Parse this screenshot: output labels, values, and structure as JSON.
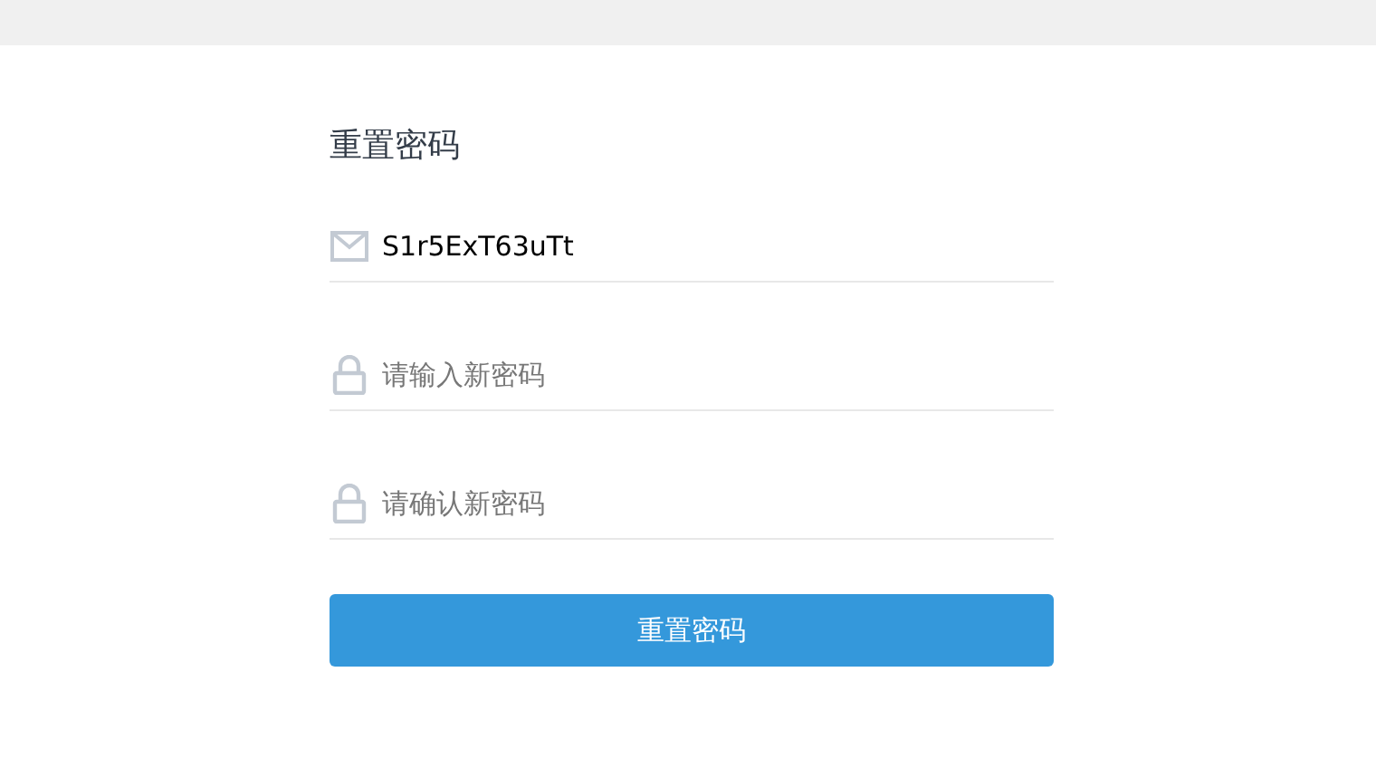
{
  "title": "重置密码",
  "fields": [
    {
      "kind": "email",
      "value": "S1r5ExT63uTt"
    },
    {
      "kind": "password",
      "placeholder": "请输入新密码"
    },
    {
      "kind": "password",
      "placeholder": "请确认新密码"
    }
  ],
  "submit": "重置密码"
}
